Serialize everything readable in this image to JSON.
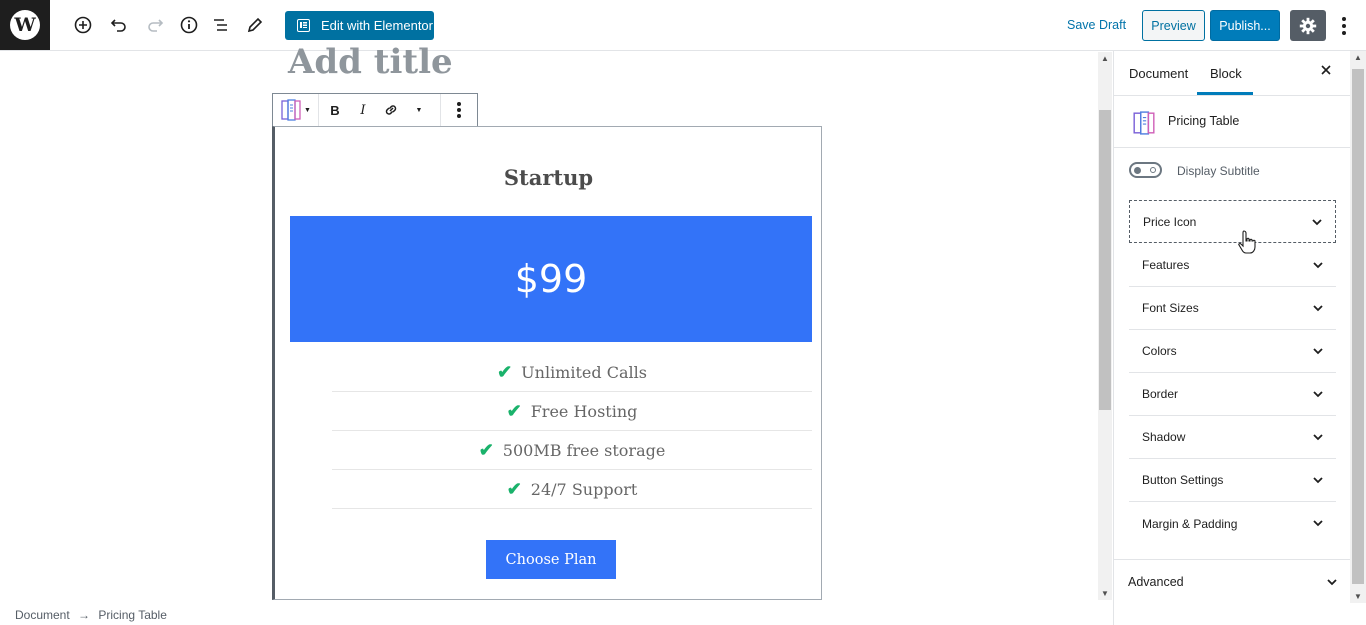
{
  "toolbar": {
    "elementor_label": "Edit with Elementor",
    "save_draft": "Save Draft",
    "preview": "Preview",
    "publish": "Publish..."
  },
  "editor": {
    "title_placeholder": "Add title"
  },
  "block_toolbar": {
    "bold": "B",
    "italic": "I"
  },
  "pricing": {
    "title": "Startup",
    "price": "$99",
    "features": [
      "Unlimited Calls",
      "Free Hosting",
      "500MB free storage",
      "24/7 Support"
    ],
    "button": "Choose Plan",
    "price_bg": "#3373f8",
    "check_color": "#1ab26b"
  },
  "breadcrumb": {
    "root": "Document",
    "arrow": "→",
    "current": "Pricing Table"
  },
  "sidebar": {
    "tabs": [
      "Document",
      "Block"
    ],
    "active_tab": "Block",
    "block_name": "Pricing Table",
    "toggle_label": "Display Subtitle",
    "toggle_on": false,
    "panels": [
      "Price Icon",
      "Features",
      "Font Sizes",
      "Colors",
      "Border",
      "Shadow",
      "Button Settings",
      "Margin & Padding"
    ],
    "advanced": "Advanced"
  },
  "colors": {
    "accent": "#007cba",
    "dark": "#1e1e1e"
  }
}
